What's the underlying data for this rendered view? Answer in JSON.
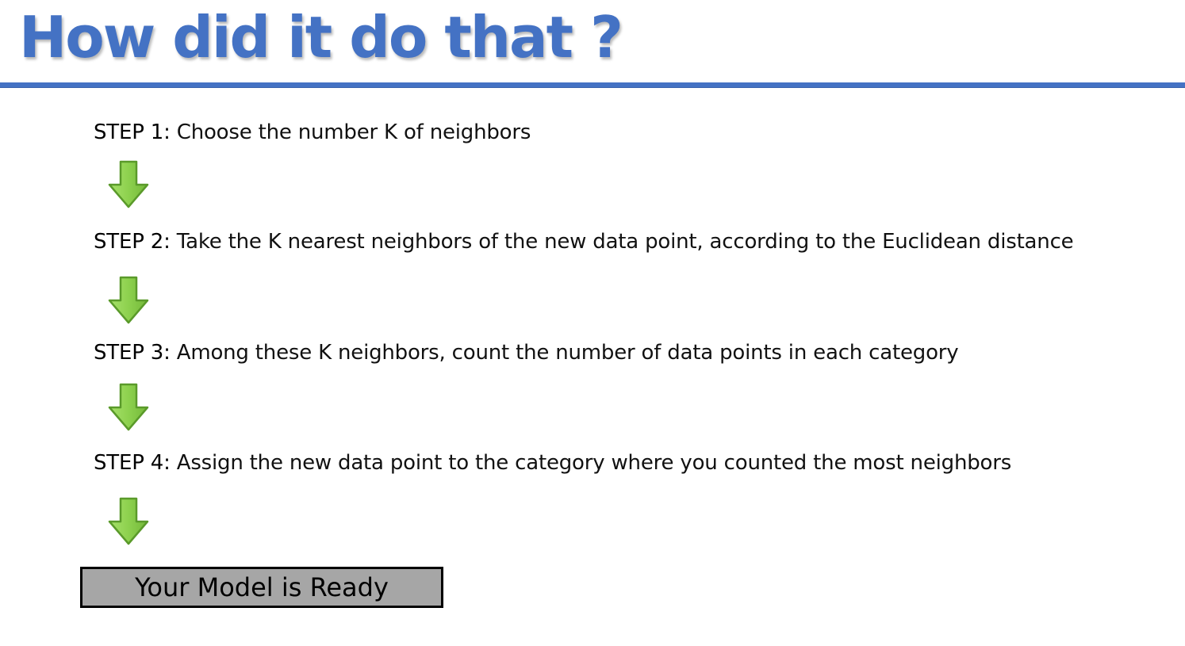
{
  "slide": {
    "title": "How did it do that ?"
  },
  "steps": [
    {
      "label": "STEP 1:",
      "text": " Choose the number K of neighbors"
    },
    {
      "label": "STEP 2:",
      "text": " Take the K nearest neighbors of the new data point, according to the Euclidean distance"
    },
    {
      "label": "STEP 3:",
      "text": " Among these K neighbors, count the number of data points in each category"
    },
    {
      "label": "STEP 4:",
      "text": " Assign the new data point to the category where you counted the most neighbors"
    }
  ],
  "result": {
    "label": "Your Model is Ready"
  },
  "colors": {
    "title": "#4472c4",
    "rule": "#4472c4",
    "arrow_fill": "#8dd14e",
    "arrow_stroke": "#5a9a2a",
    "result_fill": "#a6a6a6",
    "result_border": "#000000"
  },
  "icons": {
    "step_arrow": "down-arrow-icon"
  }
}
